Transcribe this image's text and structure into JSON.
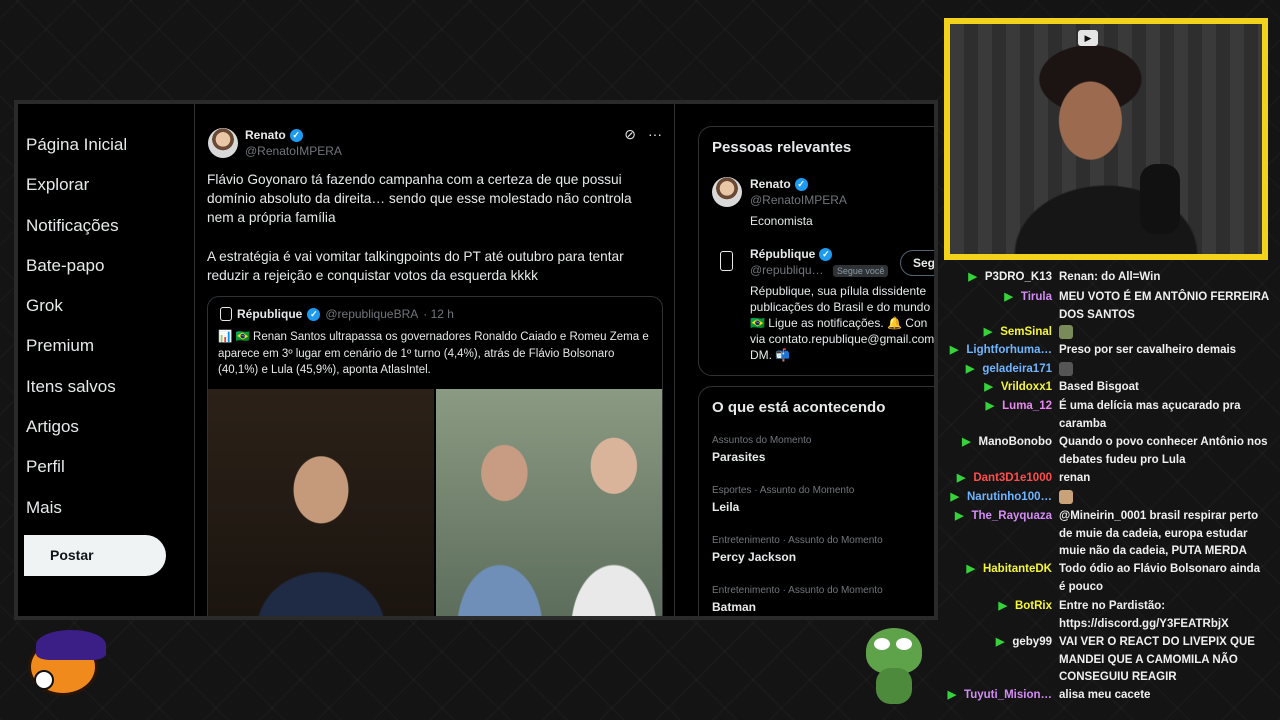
{
  "nav": {
    "items": [
      "Página Inicial",
      "Explorar",
      "Notificações",
      "Bate-papo",
      "Grok",
      "Premium",
      "Itens salvos",
      "Artigos",
      "Perfil",
      "Mais"
    ],
    "post_label": "Postar"
  },
  "tweet": {
    "author": "Renato",
    "handle": "@RenatoIMPERA",
    "text": "Flávio Goyonaro tá fazendo campanha com a certeza de que possui domínio absoluto da direita… sendo que esse molestado não controla nem a própria família\n\nA estratégia é vai vomitar talkingpoints do PT até outubro para tentar reduzir a rejeição e conquistar votos da esquerda kkkk",
    "quote": {
      "author": "République",
      "handle": "@republiqueBRA",
      "time": "· 12 h",
      "text": "📊 🇧🇷 Renan Santos ultrapassa os governadores Ronaldo Caiado e Romeu Zema e aparece em 3º lugar em cenário de 1º turno (4,4%), atrás de Flávio Bolsonaro (40,1%) e Lula (45,9%), aponta AtlasIntel."
    }
  },
  "sidebar": {
    "people_title": "Pessoas relevantes",
    "people": [
      {
        "name": "Renato",
        "handle": "@RenatoIMPERA",
        "bio": "Economista"
      },
      {
        "name": "République",
        "handle": "@republiqu…",
        "follows_you": "Segue você",
        "follow_label": "Seguir",
        "bio": "République, sua pílula dissidente\npublicações do Brasil e do mundo\n🇧🇷 Ligue as notificações. 🔔 Con\nvia contato.republique@gmail.com\nDM. 📬"
      }
    ],
    "trends_title": "O que está acontecendo",
    "trends": [
      {
        "category": "Assuntos do Momento",
        "name": "Parasites"
      },
      {
        "category": "Esportes · Assunto do Momento",
        "name": "Leila"
      },
      {
        "category": "Entretenimento · Assunto do Momento",
        "name": "Percy Jackson"
      },
      {
        "category": "Entretenimento · Assunto do Momento",
        "name": "Batman"
      }
    ]
  },
  "chat": [
    {
      "user": "P3DRO_K13",
      "color": "#f0f0f0",
      "text": "Renan: do All=Win"
    },
    {
      "user": "Tirula",
      "color": "#d48cf5",
      "text": "MEU VOTO É EM ANTÔNIO FERREIRA DOS SANTOS"
    },
    {
      "user": "SemSinal",
      "color": "#f5f53a",
      "text": ""
    },
    {
      "user": "Lightforhuma…",
      "color": "#6fb5ff",
      "text": "Preso por ser cavalheiro demais"
    },
    {
      "user": "geladeira171",
      "color": "#6fb5ff",
      "text": ""
    },
    {
      "user": "Vrildoxx1",
      "color": "#f5f53a",
      "text": "Based Bisgoat"
    },
    {
      "user": "Luma_12",
      "color": "#e987f0",
      "text": "É uma delícia mas açucarado pra caramba"
    },
    {
      "user": "ManoBonobo",
      "color": "#f0f0f0",
      "text": "Quando o povo conhecer Antônio nos debates fudeu pro Lula"
    },
    {
      "user": "Dant3D1e1000",
      "color": "#ff4d4d",
      "text": "renan"
    },
    {
      "user": "Narutinho100…",
      "color": "#6fb5ff",
      "text": ""
    },
    {
      "user": "The_Rayquaza",
      "color": "#d48cf5",
      "text": "@Mineirin_0001 brasil respirar perto de muie da cadeia, europa estudar muie não da cadeia, PUTA MERDA"
    },
    {
      "user": "HabitanteDK",
      "color": "#f5f53a",
      "text": "Todo ódio ao Flávio Bolsonaro ainda é pouco"
    },
    {
      "user": "BotRix",
      "color": "#f5f53a",
      "text": "Entre no Pardistão: https://discord.gg/Y3FEATRbjX"
    },
    {
      "user": "geby99",
      "color": "#f0f0f0",
      "text": "VAI VER O REACT DO LIVEPIX QUE MANDEI QUE A CAMOMILA NÃO CONSEGUIU REAGIR"
    },
    {
      "user": "Tuyuti_Mision…",
      "color": "#d48cf5",
      "text": "alisa meu cacete"
    }
  ],
  "icons": {
    "chat_badge": "kick-badge-icon",
    "verified": "verified-badge-icon"
  },
  "colors": {
    "accent_yellow": "#f2d21b",
    "verified_blue": "#1d9bf0",
    "badge_green": "#35d23a"
  }
}
